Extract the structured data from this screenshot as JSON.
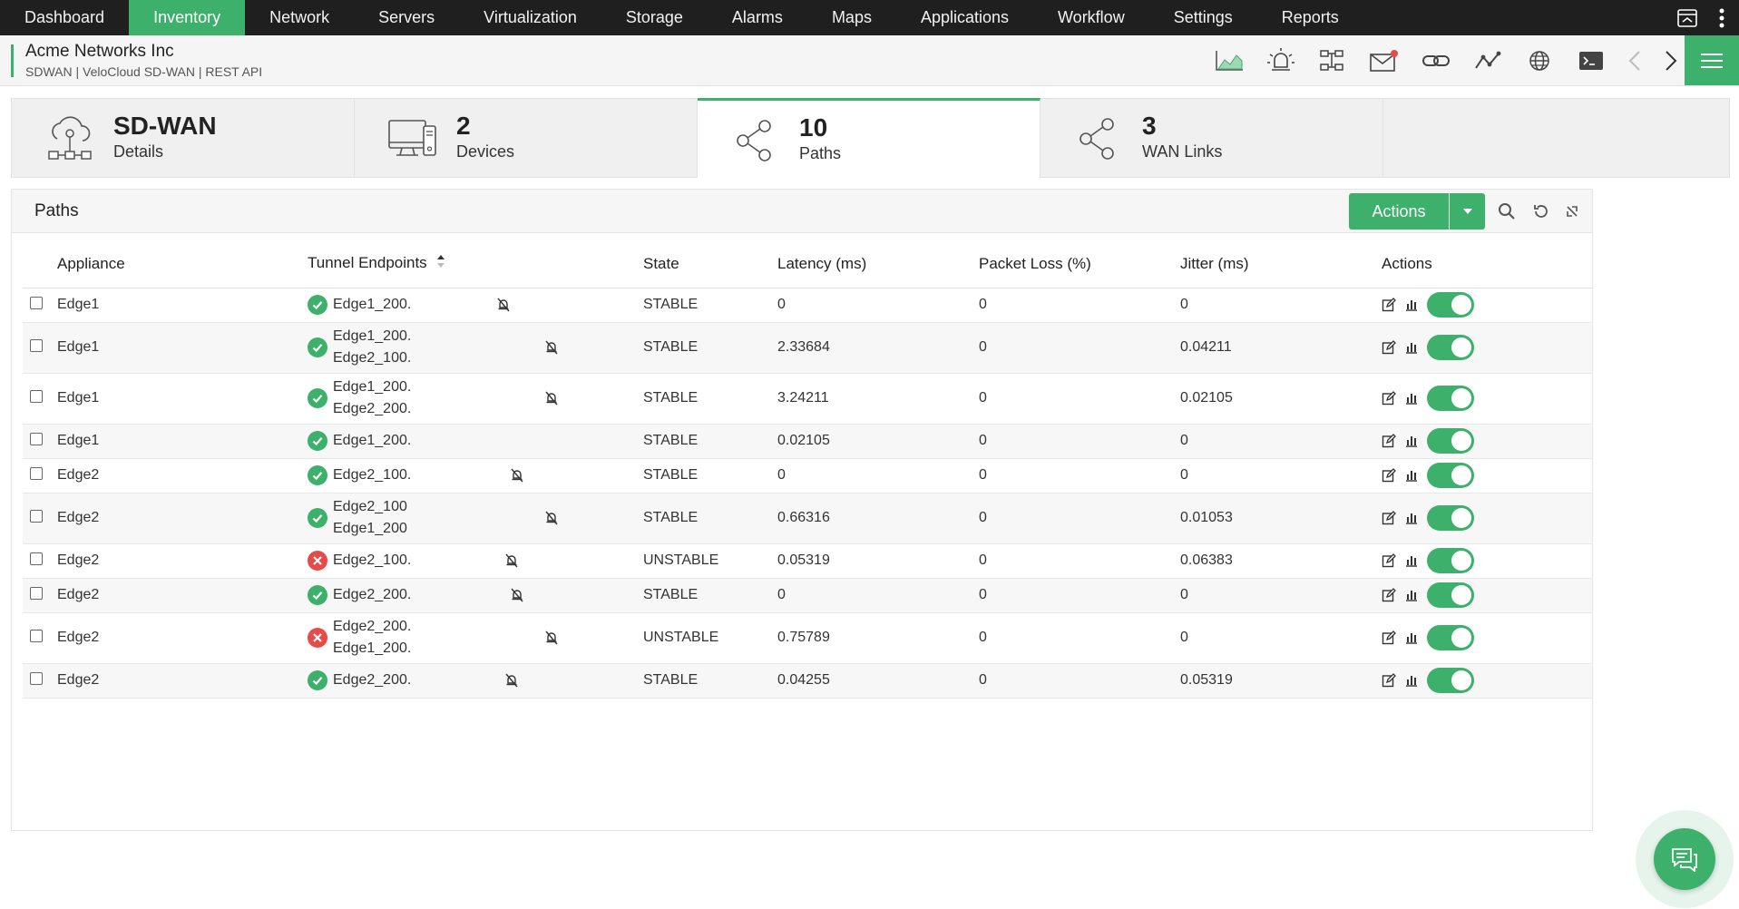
{
  "nav": {
    "items": [
      "Dashboard",
      "Inventory",
      "Network",
      "Servers",
      "Virtualization",
      "Storage",
      "Alarms",
      "Maps",
      "Applications",
      "Workflow",
      "Settings",
      "Reports"
    ],
    "active": "Inventory"
  },
  "header": {
    "title": "Acme Networks Inc",
    "breadcrumb": "SDWAN | VeloCloud SD-WAN  | REST API"
  },
  "summary": {
    "sdwan": {
      "title": "SD-WAN",
      "label": "Details"
    },
    "devices": {
      "count": "2",
      "label": "Devices"
    },
    "paths": {
      "count": "10",
      "label": "Paths"
    },
    "wan_links": {
      "count": "3",
      "label": "WAN Links"
    }
  },
  "panel": {
    "title": "Paths",
    "actions_label": "Actions"
  },
  "table": {
    "columns": {
      "appliance": "Appliance",
      "endpoints": "Tunnel Endpoints",
      "state": "State",
      "latency": "Latency (ms)",
      "packet_loss": "Packet Loss (%)",
      "jitter": "Jitter (ms)",
      "actions": "Actions"
    },
    "rows": [
      {
        "appliance": "Edge1",
        "status": "ok",
        "ep1": "Edge1_200.",
        "ep2": "",
        "state": "STABLE",
        "latency": "0",
        "packet_loss": "0",
        "jitter": "0"
      },
      {
        "appliance": "Edge1",
        "status": "ok",
        "ep1": "Edge1_200.",
        "ep2": "Edge2_100.",
        "state": "STABLE",
        "latency": "2.33684",
        "packet_loss": "0",
        "jitter": "0.04211"
      },
      {
        "appliance": "Edge1",
        "status": "ok",
        "ep1": "Edge1_200.",
        "ep2": "Edge2_200.",
        "state": "STABLE",
        "latency": "3.24211",
        "packet_loss": "0",
        "jitter": "0.02105"
      },
      {
        "appliance": "Edge1",
        "status": "ok",
        "ep1": "Edge1_200.",
        "ep2": "",
        "state": "STABLE",
        "latency": "0.02105",
        "packet_loss": "0",
        "jitter": "0"
      },
      {
        "appliance": "Edge2",
        "status": "ok",
        "ep1": "Edge2_100.",
        "ep2": "",
        "state": "STABLE",
        "latency": "0",
        "packet_loss": "0",
        "jitter": "0"
      },
      {
        "appliance": "Edge2",
        "status": "ok",
        "ep1": "Edge2_100",
        "ep2": "Edge1_200",
        "state": "STABLE",
        "latency": "0.66316",
        "packet_loss": "0",
        "jitter": "0.01053"
      },
      {
        "appliance": "Edge2",
        "status": "bad",
        "ep1": "Edge2_100.",
        "ep2": "",
        "state": "UNSTABLE",
        "latency": "0.05319",
        "packet_loss": "0",
        "jitter": "0.06383"
      },
      {
        "appliance": "Edge2",
        "status": "ok",
        "ep1": "Edge2_200.",
        "ep2": "",
        "state": "STABLE",
        "latency": "0",
        "packet_loss": "0",
        "jitter": "0"
      },
      {
        "appliance": "Edge2",
        "status": "bad",
        "ep1": "Edge2_200.",
        "ep2": "Edge1_200.",
        "state": "UNSTABLE",
        "latency": "0.75789",
        "packet_loss": "0",
        "jitter": "0"
      },
      {
        "appliance": "Edge2",
        "status": "ok",
        "ep1": "Edge2_200.",
        "ep2": "",
        "state": "STABLE",
        "latency": "0.04255",
        "packet_loss": "0",
        "jitter": "0.05319"
      }
    ]
  },
  "colors": {
    "accent": "#3db16c",
    "nav_bg": "#1f1f1f",
    "error": "#e84a4a"
  },
  "icons": {
    "header_tools": [
      "graph-icon",
      "alarm-icon",
      "topology-icon",
      "mail-icon",
      "link-icon",
      "trend-icon",
      "globe-icon",
      "terminal-icon",
      "prev-icon",
      "next-icon"
    ]
  }
}
